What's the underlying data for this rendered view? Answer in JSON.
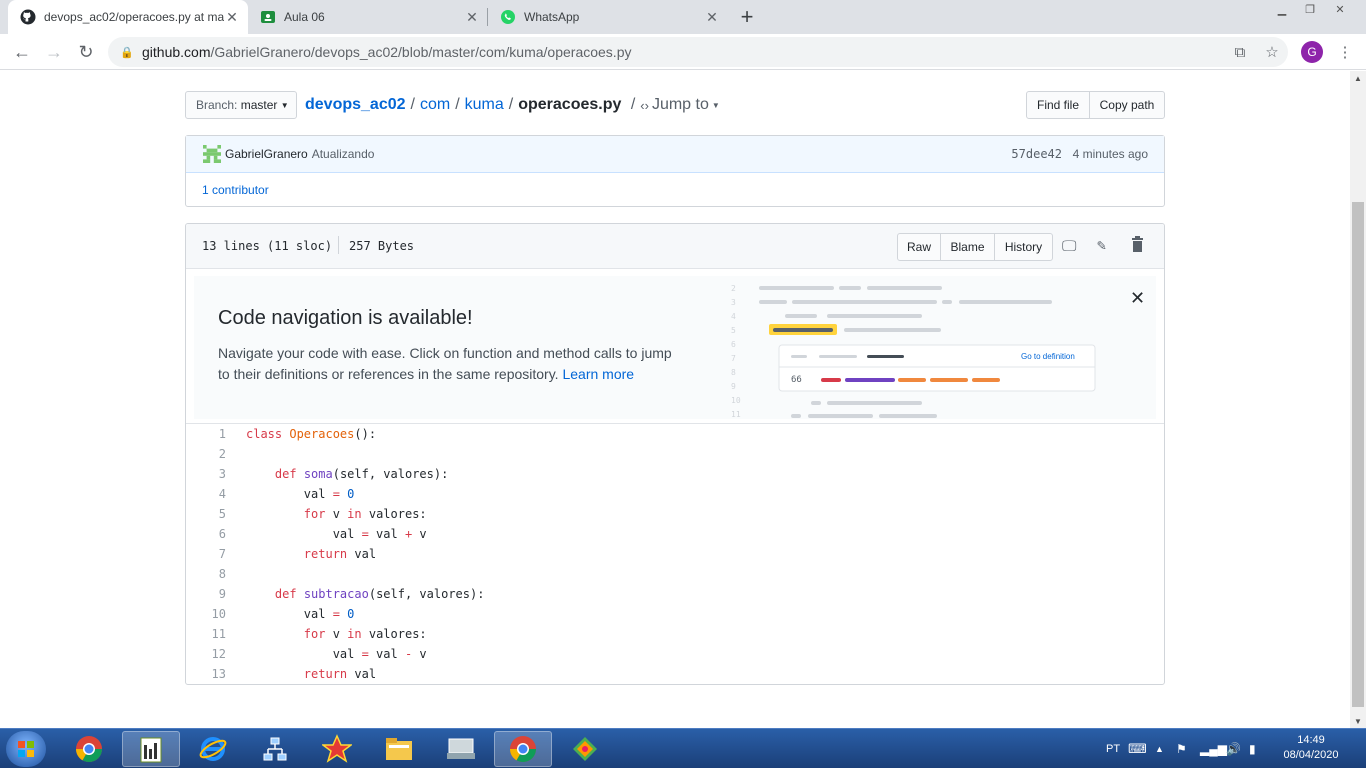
{
  "browser": {
    "tabs": [
      {
        "title": "devops_ac02/operacoes.py at ma",
        "icon": "github-icon",
        "active": true
      },
      {
        "title": "Aula 06",
        "icon": "classroom-icon",
        "active": false
      },
      {
        "title": "WhatsApp",
        "icon": "whatsapp-icon",
        "active": false
      }
    ],
    "url_host": "github.com",
    "url_path": "/GabrielGranero/devops_ac02/blob/master/com/kuma/operacoes.py",
    "profile_initial": "G"
  },
  "repo": {
    "branch_label": "Branch:",
    "branch": "master",
    "crumbs": [
      "devops_ac02",
      "com",
      "kuma"
    ],
    "file": "operacoes.py",
    "jump_to": "Jump to",
    "find_file": "Find file",
    "copy_path": "Copy path"
  },
  "commit": {
    "author": "GabrielGranero",
    "message": "Atualizando",
    "sha": "57dee42",
    "time": "4 minutes ago",
    "contributors": "1 contributor"
  },
  "file_header": {
    "lines": "13 lines (11 sloc)",
    "size": "257 Bytes",
    "raw": "Raw",
    "blame": "Blame",
    "history": "History"
  },
  "code_nav": {
    "title": "Code navigation is available!",
    "text": "Navigate your code with ease. Click on function and method calls to jump to their definitions or references in the same repository.",
    "learn_more": "Learn more",
    "go_to_definition": "Go to definition",
    "illus_number": "66",
    "illus_lines": [
      "2",
      "3",
      "4",
      "5",
      "6",
      "7",
      "8",
      "9",
      "10",
      "11"
    ]
  },
  "code_lines": [
    {
      "n": "1",
      "tokens": [
        {
          "t": "class ",
          "c": "k"
        },
        {
          "t": "Operacoes",
          "c": "c"
        },
        {
          "t": "():",
          "c": ""
        }
      ]
    },
    {
      "n": "2",
      "tokens": []
    },
    {
      "n": "3",
      "tokens": [
        {
          "t": "    ",
          "c": ""
        },
        {
          "t": "def ",
          "c": "k"
        },
        {
          "t": "soma",
          "c": "f"
        },
        {
          "t": "(self, valores):",
          "c": ""
        }
      ]
    },
    {
      "n": "4",
      "tokens": [
        {
          "t": "        val ",
          "c": ""
        },
        {
          "t": "=",
          "c": "k"
        },
        {
          "t": " ",
          "c": ""
        },
        {
          "t": "0",
          "c": "n"
        }
      ]
    },
    {
      "n": "5",
      "tokens": [
        {
          "t": "        ",
          "c": ""
        },
        {
          "t": "for",
          "c": "k"
        },
        {
          "t": " v ",
          "c": ""
        },
        {
          "t": "in",
          "c": "k"
        },
        {
          "t": " valores:",
          "c": ""
        }
      ]
    },
    {
      "n": "6",
      "tokens": [
        {
          "t": "            val ",
          "c": ""
        },
        {
          "t": "=",
          "c": "k"
        },
        {
          "t": " val ",
          "c": ""
        },
        {
          "t": "+",
          "c": "k"
        },
        {
          "t": " v",
          "c": ""
        }
      ]
    },
    {
      "n": "7",
      "tokens": [
        {
          "t": "        ",
          "c": ""
        },
        {
          "t": "return",
          "c": "k"
        },
        {
          "t": " val",
          "c": ""
        }
      ]
    },
    {
      "n": "8",
      "tokens": []
    },
    {
      "n": "9",
      "tokens": [
        {
          "t": "    ",
          "c": ""
        },
        {
          "t": "def ",
          "c": "k"
        },
        {
          "t": "subtracao",
          "c": "f"
        },
        {
          "t": "(self, valores):",
          "c": ""
        }
      ]
    },
    {
      "n": "10",
      "tokens": [
        {
          "t": "        val ",
          "c": ""
        },
        {
          "t": "=",
          "c": "k"
        },
        {
          "t": " ",
          "c": ""
        },
        {
          "t": "0",
          "c": "n"
        }
      ]
    },
    {
      "n": "11",
      "tokens": [
        {
          "t": "        ",
          "c": ""
        },
        {
          "t": "for",
          "c": "k"
        },
        {
          "t": " v ",
          "c": ""
        },
        {
          "t": "in",
          "c": "k"
        },
        {
          "t": " valores:",
          "c": ""
        }
      ]
    },
    {
      "n": "12",
      "tokens": [
        {
          "t": "            val ",
          "c": ""
        },
        {
          "t": "=",
          "c": "k"
        },
        {
          "t": " val ",
          "c": ""
        },
        {
          "t": "-",
          "c": "k"
        },
        {
          "t": " v",
          "c": ""
        }
      ]
    },
    {
      "n": "13",
      "tokens": [
        {
          "t": "        ",
          "c": ""
        },
        {
          "t": "return",
          "c": "k"
        },
        {
          "t": " val",
          "c": ""
        }
      ]
    }
  ],
  "taskbar": {
    "apps": [
      "chrome-icon",
      "notepad-icon",
      "ie-icon",
      "network-icon",
      "star-app-icon",
      "explorer-icon",
      "keyboard-app-icon",
      "chrome-active-icon",
      "paint-icon"
    ],
    "lang": "PT",
    "time": "14:49",
    "date": "08/04/2020"
  },
  "colors": {
    "link": "#0366d6",
    "keyword": "#d73a49",
    "function": "#6f42c1",
    "class": "#e36209",
    "number": "#005cc5"
  }
}
